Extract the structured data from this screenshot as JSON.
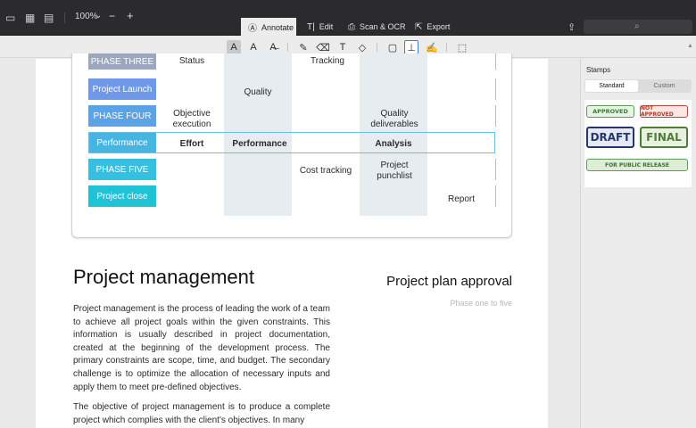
{
  "toolbar": {
    "zoom": "100%",
    "zoom_chevron": "⌄",
    "zoom_out": "−",
    "zoom_in": "+",
    "tabs": [
      {
        "label": "Annotate",
        "icon": "Ⓐ"
      },
      {
        "label": "Edit",
        "icon": "T|"
      },
      {
        "label": "Scan & OCR",
        "icon": "⎙"
      },
      {
        "label": "Export",
        "icon": "⇱"
      }
    ],
    "icons": {
      "sidebar": "▭",
      "grid": "▦",
      "page_view": "▤",
      "share": "⇪",
      "search": "⌕"
    }
  },
  "annotation_tools": [
    {
      "name": "text-highlight-icon",
      "glyph": "A"
    },
    {
      "name": "text-size-icon",
      "glyph": "A"
    },
    {
      "name": "strikethrough-icon",
      "glyph": "A̶"
    },
    {
      "name": "pen-icon",
      "glyph": "✎"
    },
    {
      "name": "eraser-icon",
      "glyph": "⌫"
    },
    {
      "name": "text-box-icon",
      "glyph": "T"
    },
    {
      "name": "shapes-icon",
      "glyph": "◇"
    },
    {
      "name": "comment-icon",
      "glyph": "▢"
    },
    {
      "name": "stamp-icon",
      "glyph": "⊥"
    },
    {
      "name": "signature-icon",
      "glyph": "✍"
    },
    {
      "name": "crop-icon",
      "glyph": "⬚"
    }
  ],
  "table": {
    "phases": [
      {
        "label": "PHASE THREE",
        "color": "#9aa7bd"
      },
      {
        "label": "Project Launch",
        "color": "#6f99e8"
      },
      {
        "label": "PHASE FOUR",
        "color": "#5aa3e6"
      },
      {
        "label": "Performance",
        "color": "#47b5e2"
      },
      {
        "label": "PHASE FIVE",
        "color": "#35bfe0"
      },
      {
        "label": "Project close",
        "color": "#20c3d6"
      }
    ],
    "cells": {
      "status": "Status",
      "tracking": "Tracking",
      "quality": "Quality",
      "objective_execution": "Objective execution",
      "quality_deliverables": "Quality deliverables",
      "effort": "Effort",
      "performance": "Performance",
      "analysis": "Analysis",
      "cost_tracking": "Cost tracking",
      "project_punchlist": "Project punchlist",
      "report": "Report"
    }
  },
  "content": {
    "title": "Project management",
    "side_title": "Project plan approval",
    "side_subtitle": "Phase one to five",
    "paragraph1": "Project management is the process of leading the work of a team to achieve all project goals within the given constraints. This information is usually described in project documentation, created at the beginning of the development process. The primary constraints are scope, time, and budget. The secondary challenge is to optimize the allocation of necessary inputs and apply them to meet pre-defined objectives.",
    "paragraph2": "The objective of project management is to produce a complete project which complies with the client's objectives. In many"
  },
  "sidebar": {
    "title": "Stamps",
    "segments": [
      "Standard",
      "Custom"
    ],
    "stamps": {
      "approved": "APPROVED",
      "not_approved": "NOT APPROVED",
      "draft": "DRAFT",
      "final": "FINAL",
      "release": "FOR PUBLIC RELEASE"
    }
  }
}
